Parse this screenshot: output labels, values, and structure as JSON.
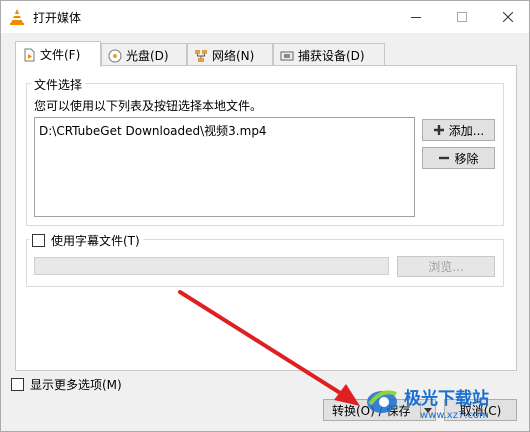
{
  "window": {
    "title": "打开媒体"
  },
  "tabs": [
    {
      "label": "文件(F)",
      "icon": "file-icon"
    },
    {
      "label": "光盘(D)",
      "icon": "disc-icon"
    },
    {
      "label": "网络(N)",
      "icon": "network-icon"
    },
    {
      "label": "捕获设备(D)",
      "icon": "capture-device-icon"
    }
  ],
  "file_selection": {
    "group_label": "文件选择",
    "description": "您可以使用以下列表及按钮选择本地文件。",
    "files": [
      "D:\\CRTubeGet Downloaded\\视频3.mp4"
    ],
    "add_label": "添加...",
    "remove_label": "移除"
  },
  "subtitle": {
    "checkbox_label": "使用字幕文件(T)",
    "checked": false,
    "browse_label": "浏览..."
  },
  "bottom": {
    "more_options_label": "显示更多选项(M)",
    "convert_save_label": "转换(O) / 保存",
    "cancel_label": "取消(C)"
  },
  "watermark": {
    "text": "极光下载站",
    "url": "www.xz7.com"
  },
  "colors": {
    "accent_arrow": "#e02020",
    "vlc_orange": "#f08a00",
    "watermark_blue": "#1a6fd0"
  }
}
